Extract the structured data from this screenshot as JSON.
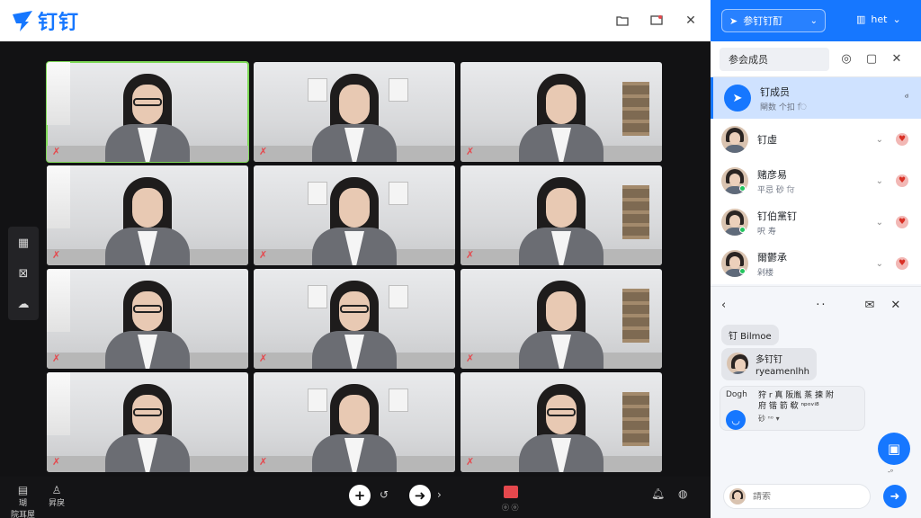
{
  "app": {
    "logo_text": "钉钉"
  },
  "panel": {
    "meeting_dropdown": "参钉钉酊",
    "user_label": "het",
    "tab_label": "参会成员"
  },
  "members": [
    {
      "name": "钉成员",
      "sub": "閘数 个扣 ਿ",
      "selected": true
    },
    {
      "name": "钉虛",
      "sub": ""
    },
    {
      "name": "赌彦易",
      "sub": "平忌 砂 ਰਿ"
    },
    {
      "name": "钉伯黨钉",
      "sub": "呎 寿"
    },
    {
      "name": "爾鬱承",
      "sub": "剁楼"
    }
  ],
  "chat": {
    "b1": "钉 Bilmoe",
    "b2_line1": "多钉钉",
    "b2_line2": "ryeamenlhh",
    "b3_who": "Dogh",
    "b3_line1": "狩 r 真 阪胤 蒸 揀 附",
    "b3_line2": "府 锴 箭 欷 ⁿᵖᵒᵛⁱ⁸",
    "b3_small": "砂 ⁿᵒ ▾",
    "float_label": "-ᵒ",
    "input_placeholder": "請索"
  },
  "bottom": {
    "left1": "瑚\n院耳屋",
    "left2": "昇戾",
    "rec_sub": "ⓞ ⓞ"
  },
  "tiles": [
    {
      "active": true,
      "glasses": true
    },
    {
      "active": false,
      "glasses": false
    },
    {
      "active": false,
      "glasses": false
    },
    {
      "active": false,
      "glasses": false
    },
    {
      "active": false,
      "glasses": false
    },
    {
      "active": false,
      "glasses": false
    },
    {
      "active": false,
      "glasses": true
    },
    {
      "active": false,
      "glasses": true
    },
    {
      "active": false,
      "glasses": false
    },
    {
      "active": false,
      "glasses": true
    },
    {
      "active": false,
      "glasses": false
    },
    {
      "active": false,
      "glasses": true
    }
  ],
  "colors": {
    "accent": "#1677ff",
    "active_border": "#7ed957",
    "mute": "#e5484d"
  }
}
